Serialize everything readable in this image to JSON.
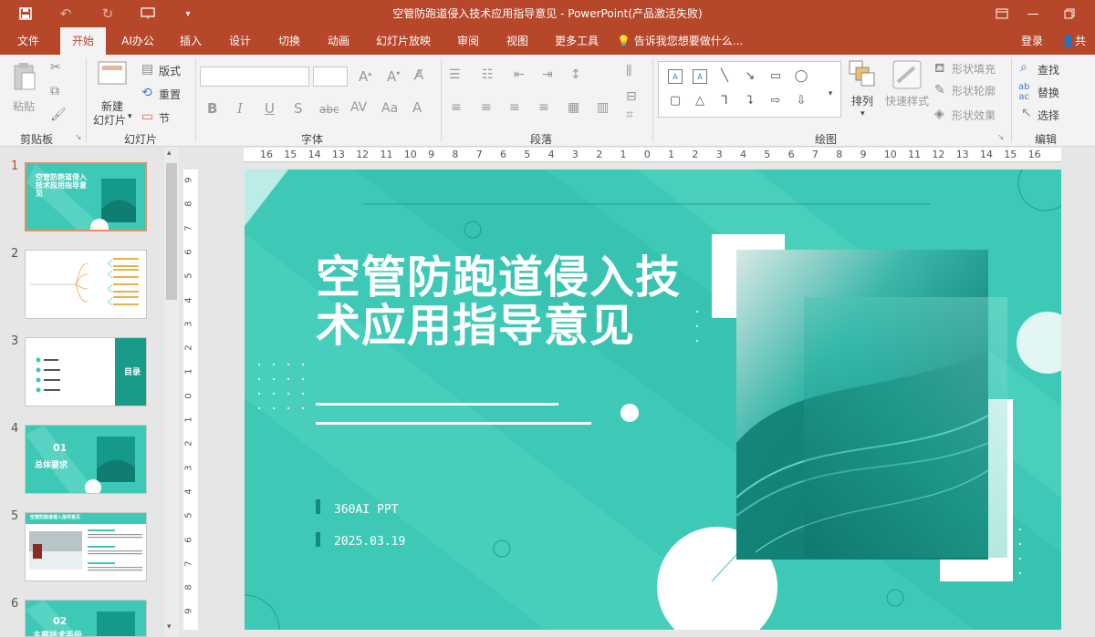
{
  "app": {
    "window_title": "空管防跑道侵入技术应用指导意见 - PowerPoint(产品激活失败)"
  },
  "menu": {
    "tabs": [
      "文件",
      "开始",
      "AI办公",
      "插入",
      "设计",
      "切换",
      "动画",
      "幻灯片放映",
      "审阅",
      "视图",
      "更多工具"
    ],
    "active_tab": "开始",
    "tell_me": "告诉我您想要做什么...",
    "login": "登录",
    "share": "共"
  },
  "ribbon": {
    "clipboard": {
      "paste": "粘贴",
      "label": "剪贴板"
    },
    "slides": {
      "new_slide_1": "新建",
      "new_slide_2": "幻灯片",
      "layout": "版式",
      "reset": "重置",
      "section": "节",
      "label": "幻灯片"
    },
    "font": {
      "label": "字体"
    },
    "paragraph": {
      "label": "段落"
    },
    "drawing": {
      "arrange": "排列",
      "quick_styles": "快速样式",
      "shape_fill": "形状填充",
      "shape_outline": "形状轮廓",
      "shape_effects": "形状效果",
      "label": "绘图"
    },
    "editing": {
      "find": "查找",
      "replace": "替换",
      "select": "选择",
      "label": "编辑"
    }
  },
  "thumbnails": {
    "numbers": [
      "1",
      "2",
      "3",
      "4",
      "5",
      "6"
    ],
    "t1_title": "空管防跑道侵入技术应用指导意见",
    "t3_title": "目录",
    "t4_num": "01",
    "t4_title": "总体要求",
    "t5_title": "空管防跑道侵入指导意见",
    "t6_num": "02",
    "t6_title": "主要技术手段"
  },
  "ruler": {
    "h": [
      "16",
      "15",
      "14",
      "13",
      "12",
      "11",
      "10",
      "9",
      "8",
      "7",
      "6",
      "5",
      "4",
      "3",
      "2",
      "1",
      "0",
      "1",
      "2",
      "3",
      "4",
      "5",
      "6",
      "7",
      "8",
      "9",
      "10",
      "11",
      "12",
      "13",
      "14",
      "15",
      "16"
    ],
    "v": [
      "9",
      "8",
      "7",
      "6",
      "5",
      "4",
      "3",
      "2",
      "1",
      "0",
      "1",
      "2",
      "3",
      "4",
      "5",
      "6",
      "7",
      "8",
      "9"
    ]
  },
  "slide": {
    "title": "空管防跑道侵入技术应用指导意见",
    "author": "360AI PPT",
    "date": "2025.03.19"
  },
  "colors": {
    "title_bar": "#b7472a",
    "slide_bg": "#3ec9b6",
    "accent_dark": "#138a7c"
  }
}
